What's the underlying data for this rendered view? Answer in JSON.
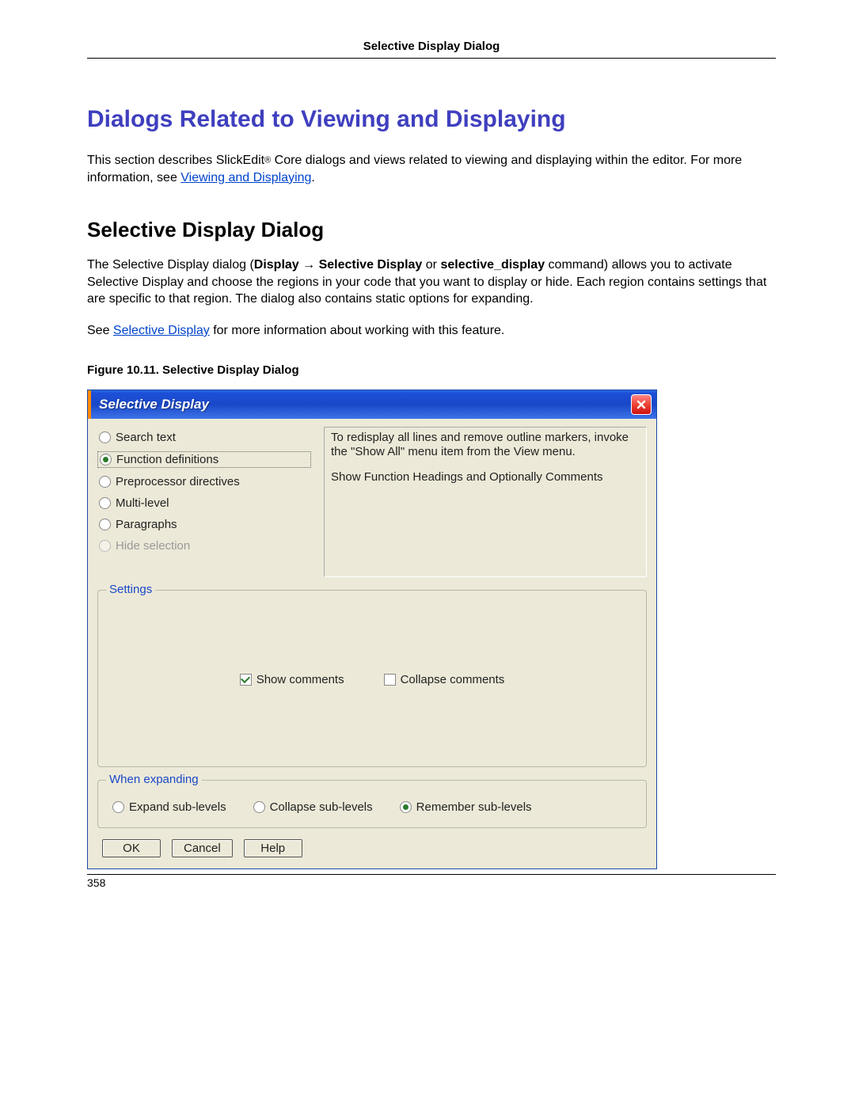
{
  "header": {
    "title": "Selective Display Dialog"
  },
  "main_heading": "Dialogs Related to Viewing and Displaying",
  "intro": {
    "pre": "This section describes SlickEdit",
    "reg": "®",
    "mid": " Core dialogs and views related to viewing and displaying within the editor. For more information, see ",
    "link": "Viewing and Displaying",
    "post": "."
  },
  "sub_heading": "Selective Display Dialog",
  "p1": {
    "a": "The Selective Display dialog (",
    "b": "Display",
    "arrow": " → ",
    "c": "Selective Display",
    "d": " or ",
    "e": "selective_display",
    "f": " command) allows you to activate Selective Display and choose the regions in your code that you want to display or hide. Each region contains settings that are specific to that region. The dialog also contains static options for expanding."
  },
  "p2": {
    "a": "See ",
    "link": "Selective Display",
    "b": " for more information about working with this feature."
  },
  "figure_caption": "Figure 10.11. Selective Display Dialog",
  "dialog": {
    "title": "Selective Display",
    "radios": [
      {
        "label": "Search text",
        "selected": false,
        "disabled": false
      },
      {
        "label": "Function definitions",
        "selected": true,
        "disabled": false
      },
      {
        "label": "Preprocessor directives",
        "selected": false,
        "disabled": false
      },
      {
        "label": "Multi-level",
        "selected": false,
        "disabled": false
      },
      {
        "label": "Paragraphs",
        "selected": false,
        "disabled": false
      },
      {
        "label": "Hide selection",
        "selected": false,
        "disabled": true
      }
    ],
    "description": {
      "line1": "To redisplay all lines and remove outline markers, invoke the \"Show All\" menu item from the View menu.",
      "line2": "Show Function Headings and Optionally Comments"
    },
    "settings": {
      "legend": "Settings",
      "show_comments": {
        "label": "Show comments",
        "checked": true
      },
      "collapse_comments": {
        "label": "Collapse comments",
        "checked": false
      }
    },
    "expanding": {
      "legend": "When expanding",
      "options": [
        {
          "label": "Expand sub-levels",
          "selected": false
        },
        {
          "label": "Collapse sub-levels",
          "selected": false
        },
        {
          "label": "Remember sub-levels",
          "selected": true
        }
      ]
    },
    "buttons": {
      "ok": "OK",
      "cancel": "Cancel",
      "help": "Help"
    }
  },
  "page_number": "358"
}
